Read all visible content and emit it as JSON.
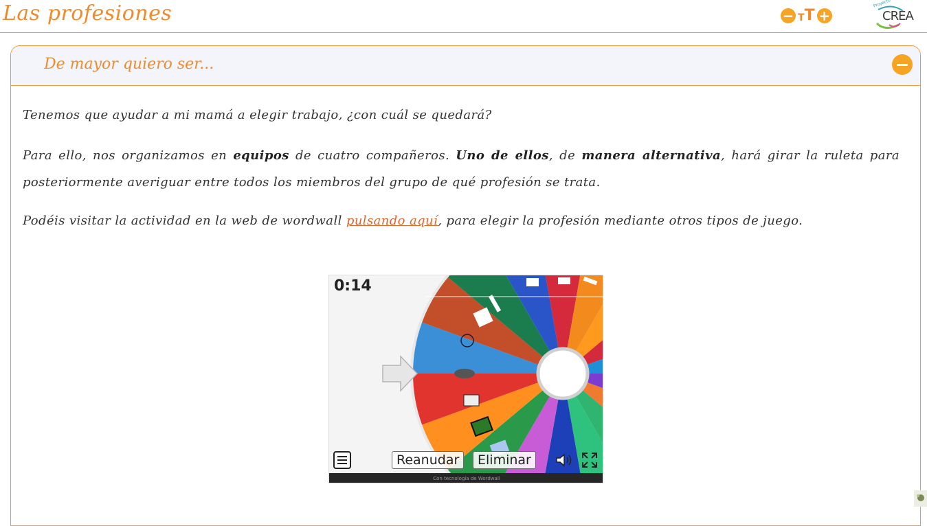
{
  "header": {
    "title": "Las profesiones",
    "font_decrease_label": "−",
    "font_size_label_small": "T",
    "font_size_label_big": "T",
    "font_increase_label": "+",
    "logo_text": "CREA",
    "logo_small_text": "Proyecto"
  },
  "card": {
    "title": "De mayor quiero ser...",
    "collapse_label": "−"
  },
  "content": {
    "p1": "Tenemos que ayudar a mi mamá a elegir trabajo, ¿con cuál se quedará?",
    "p2_a": "Para ello, nos organizamos en ",
    "p2_b": "equipos",
    "p2_c": " de cuatro compañeros. ",
    "p2_d": "Uno de ellos",
    "p2_e": ", de ",
    "p2_f": "manera alternativa",
    "p2_g": ", hará girar la ruleta para posteriormente averiguar entre todos los miembros del grupo de qué profesión se trata.",
    "p3_a": "Podéis visitar la actividad en la web de wordwall ",
    "p3_link": "pulsando aquí",
    "p3_b": ", para elegir la profesión mediante otros tipos de juego."
  },
  "game": {
    "timer": "0:14",
    "resume_button": "Reanudar",
    "remove_button": "Eliminar",
    "footer": "Con tecnología de Wordwall",
    "segment_colors": [
      "#d42a3b",
      "#f28a1e",
      "#ff9a1e",
      "#d42a3b",
      "#1e90d8",
      "#7b3dd1",
      "#f07a30",
      "#2fb570",
      "#2ec27e",
      "#1d3fb8",
      "#c85cd6",
      "#2a9a4a",
      "#ff8f1e",
      "#e2342f",
      "#3a8fd6",
      "#c24f2a",
      "#1b7d4e",
      "#2a55c8"
    ]
  }
}
